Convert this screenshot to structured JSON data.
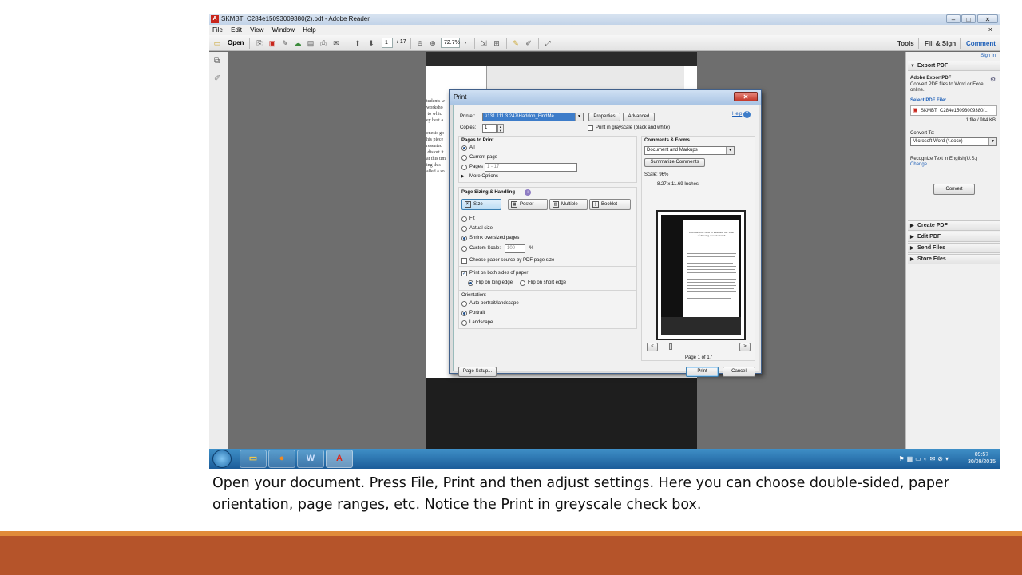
{
  "window": {
    "title": "SKMBT_C284e15093009380(2).pdf - Adobe Reader",
    "controls": [
      "–",
      "□",
      "✕"
    ]
  },
  "menubar": {
    "items": [
      "File",
      "Edit",
      "View",
      "Window",
      "Help"
    ],
    "close": "×"
  },
  "toolbar": {
    "open_label": "Open",
    "page_number": "1",
    "page_total": "/ 17",
    "zoom": "72.7%",
    "tabs": [
      "Tools",
      "Fill & Sign",
      "Comment"
    ]
  },
  "right_panel": {
    "sign_in": "Sign In",
    "export_pdf": {
      "header": "Export PDF",
      "service_name": "Adobe ExportPDF",
      "description": "Convert PDF files to Word or Excel online.",
      "select_label": "Select PDF File:",
      "file_name": "SKMBT_C284e15093009380(...",
      "file_count": "1 file / 984 KB",
      "convert_to_label": "Convert To:",
      "convert_to_value": "Microsoft Word (*.docx)",
      "recognize_text": "Recognize Text in English(U.S.)",
      "change_link": "Change",
      "convert_button": "Convert"
    },
    "sections": [
      "Create PDF",
      "Edit PDF",
      "Send Files",
      "Store Files"
    ]
  },
  "document_page": {
    "visible_text": "tudents w\nworksho\n to whic\ney best a\n\nenesis go\nhis piece\nresented\n distort it\nat this tim\ning this\nalled a so"
  },
  "print_dialog": {
    "title": "Print",
    "close": "✕",
    "help_link": "Help",
    "printer_label": "Printer:",
    "printer_value": "\\\\131.111.3.247\\Haddon_FindMe",
    "properties_button": "Properties",
    "advanced_button": "Advanced",
    "copies_label": "Copies:",
    "copies_value": "1",
    "grayscale_label": "Print in grayscale (black and white)",
    "pages_to_print": {
      "heading": "Pages to Print",
      "options": [
        "All",
        "Current page",
        "Pages"
      ],
      "pages_range": "1 - 17",
      "more_options": "More Options",
      "selected": "All"
    },
    "page_sizing": {
      "heading": "Page Sizing & Handling",
      "buttons": [
        "Size",
        "Poster",
        "Multiple",
        "Booklet"
      ],
      "options": [
        "Fit",
        "Actual size",
        "Shrink oversized pages",
        "Custom Scale:"
      ],
      "selected": "Shrink oversized pages",
      "custom_scale_value": "100",
      "custom_scale_unit": "%",
      "paper_source_label": "Choose paper source by PDF page size"
    },
    "duplex": {
      "label": "Print on both sides of paper",
      "checked": true,
      "options": [
        "Flip on long edge",
        "Flip on short edge"
      ],
      "selected": "Flip on long edge"
    },
    "orientation": {
      "heading": "Orientation:",
      "options": [
        "Auto portrait/landscape",
        "Portrait",
        "Landscape"
      ],
      "selected": "Portrait"
    },
    "comments_forms": {
      "heading": "Comments & Forms",
      "value": "Document and Markups",
      "summarize_button": "Summarize Comments"
    },
    "preview": {
      "scale": "Scale: 96%",
      "paper_size": "8.27 x 11.69 Inches",
      "page_text": "Introduction: How to Reassess the Task of Tracing Associations*",
      "page_indicator": "Page 1 of 17",
      "prev": "<",
      "next": ">"
    },
    "page_setup_button": "Page Setup...",
    "print_button": "Print",
    "cancel_button": "Cancel"
  },
  "taskbar": {
    "time": "09:57",
    "date": "30/09/2015"
  },
  "caption": "Open your document. Press File, Print and then adjust settings. Here you can choose double-sided, paper orientation, page ranges, etc. Notice the Print in greyscale check box.",
  "colors": {
    "footer_bar": "#b5542a",
    "footer_accent": "#e08b3a",
    "taskbar": "#1b5c99",
    "dialog_title": "#a9c4e4"
  }
}
